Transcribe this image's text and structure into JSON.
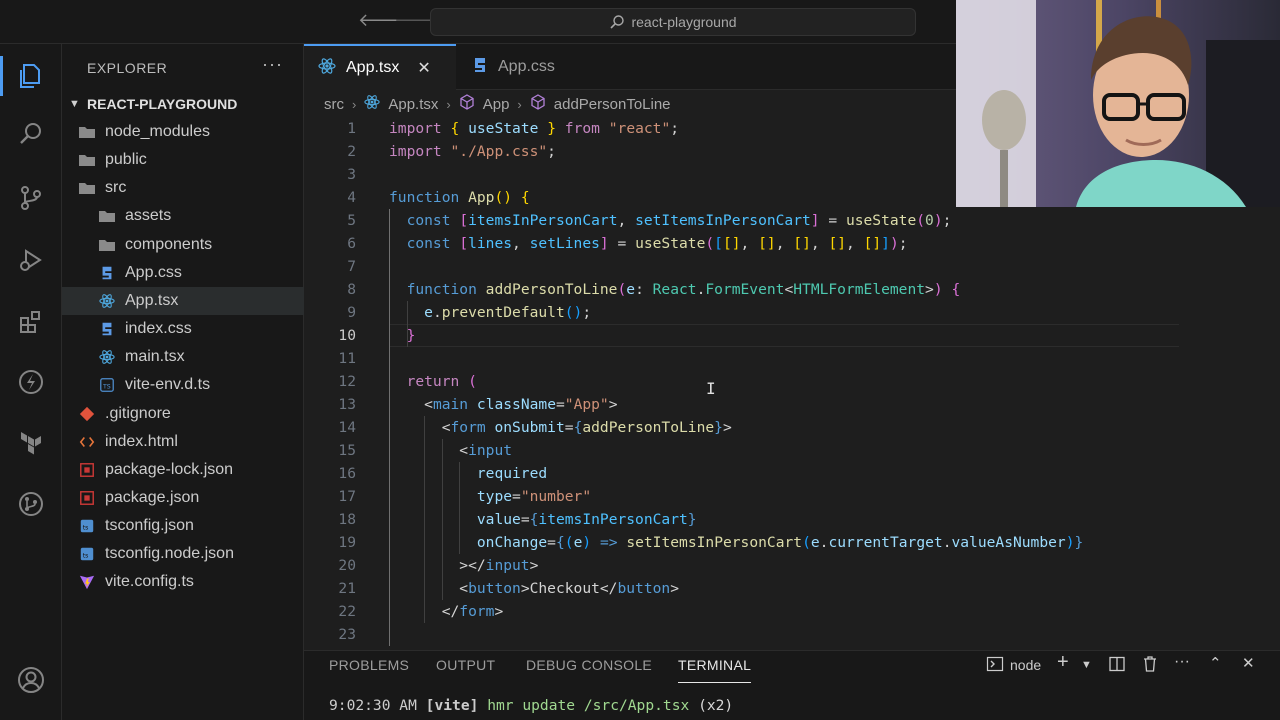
{
  "titlebar": {
    "search_text": "react-playground"
  },
  "sidebar": {
    "title": "EXPLORER",
    "more": "···",
    "project": "REACT-PLAYGROUND",
    "items": [
      {
        "label": "node_modules",
        "icon": "folder-icon",
        "indent": 0
      },
      {
        "label": "public",
        "icon": "folder-icon",
        "indent": 0
      },
      {
        "label": "src",
        "icon": "folder-icon",
        "indent": 0
      },
      {
        "label": "assets",
        "icon": "folder-icon",
        "indent": 1
      },
      {
        "label": "components",
        "icon": "folder-icon",
        "indent": 1
      },
      {
        "label": "App.css",
        "icon": "css-file-icon",
        "indent": 1
      },
      {
        "label": "App.tsx",
        "icon": "react-file-icon",
        "indent": 1,
        "selected": true
      },
      {
        "label": "index.css",
        "icon": "css-file-icon",
        "indent": 1
      },
      {
        "label": "main.tsx",
        "icon": "react-file-icon",
        "indent": 1
      },
      {
        "label": "vite-env.d.ts",
        "icon": "typescript-file-icon",
        "indent": 1
      },
      {
        "label": ".gitignore",
        "icon": "git-file-icon",
        "indent": 0
      },
      {
        "label": "index.html",
        "icon": "html-file-icon",
        "indent": 0
      },
      {
        "label": "package-lock.json",
        "icon": "npm-file-icon",
        "indent": 0
      },
      {
        "label": "package.json",
        "icon": "npm-file-icon",
        "indent": 0
      },
      {
        "label": "tsconfig.json",
        "icon": "tsconfig-file-icon",
        "indent": 0
      },
      {
        "label": "tsconfig.node.json",
        "icon": "tsconfig-file-icon",
        "indent": 0
      },
      {
        "label": "vite.config.ts",
        "icon": "vite-file-icon",
        "indent": 0
      }
    ]
  },
  "editor": {
    "tabs": [
      {
        "label": "App.tsx",
        "icon": "react-file-icon",
        "active": true,
        "close": "✕"
      },
      {
        "label": "App.css",
        "icon": "css-file-icon",
        "active": false
      }
    ],
    "breadcrumbs": [
      "src",
      "App.tsx",
      "App",
      "addPersonToLine"
    ],
    "current_line": 10,
    "lines": [
      [
        [
          "kw",
          "import"
        ],
        [
          "pn",
          " "
        ],
        [
          "br1",
          "{"
        ],
        [
          "pn",
          " "
        ],
        [
          "vr",
          "useState"
        ],
        [
          "pn",
          " "
        ],
        [
          "br1",
          "}"
        ],
        [
          "pn",
          " "
        ],
        [
          "kw",
          "from"
        ],
        [
          "pn",
          " "
        ],
        [
          "st",
          "\"react\""
        ],
        [
          "pn",
          ";"
        ]
      ],
      [
        [
          "kw",
          "import"
        ],
        [
          "pn",
          " "
        ],
        [
          "st",
          "\"./App.css\""
        ],
        [
          "pn",
          ";"
        ]
      ],
      [],
      [
        [
          "kb",
          "function"
        ],
        [
          "pn",
          " "
        ],
        [
          "fn",
          "App"
        ],
        [
          "br1",
          "()"
        ],
        [
          "pn",
          " "
        ],
        [
          "br1",
          "{"
        ]
      ],
      [
        [
          "pn",
          "  "
        ],
        [
          "kb",
          "const"
        ],
        [
          "pn",
          " "
        ],
        [
          "br2",
          "["
        ],
        [
          "cn",
          "itemsInPersonCart"
        ],
        [
          "pn",
          ", "
        ],
        [
          "cn",
          "setItemsInPersonCart"
        ],
        [
          "br2",
          "]"
        ],
        [
          "pn",
          " = "
        ],
        [
          "fn",
          "useState"
        ],
        [
          "br2",
          "("
        ],
        [
          "nm",
          "0"
        ],
        [
          "br2",
          ")"
        ],
        [
          "pn",
          ";"
        ]
      ],
      [
        [
          "pn",
          "  "
        ],
        [
          "kb",
          "const"
        ],
        [
          "pn",
          " "
        ],
        [
          "br2",
          "["
        ],
        [
          "cn",
          "lines"
        ],
        [
          "pn",
          ", "
        ],
        [
          "cn",
          "setLines"
        ],
        [
          "br2",
          "]"
        ],
        [
          "pn",
          " = "
        ],
        [
          "fn",
          "useState"
        ],
        [
          "br2",
          "("
        ],
        [
          "br3",
          "["
        ],
        [
          "br1",
          "[]"
        ],
        [
          "pn",
          ", "
        ],
        [
          "br1",
          "[]"
        ],
        [
          "pn",
          ", "
        ],
        [
          "br1",
          "[]"
        ],
        [
          "pn",
          ", "
        ],
        [
          "br1",
          "[]"
        ],
        [
          "pn",
          ", "
        ],
        [
          "br1",
          "[]"
        ],
        [
          "br3",
          "]"
        ],
        [
          "br2",
          ")"
        ],
        [
          "pn",
          ";"
        ]
      ],
      [],
      [
        [
          "pn",
          "  "
        ],
        [
          "kb",
          "function"
        ],
        [
          "pn",
          " "
        ],
        [
          "fn",
          "addPersonToLine"
        ],
        [
          "br2",
          "("
        ],
        [
          "vr",
          "e"
        ],
        [
          "pn",
          ": "
        ],
        [
          "tp",
          "React"
        ],
        [
          "pn",
          "."
        ],
        [
          "tp",
          "FormEvent"
        ],
        [
          "pn",
          "<"
        ],
        [
          "tp",
          "HTMLFormElement"
        ],
        [
          "pn",
          ">"
        ],
        [
          "br2",
          ")"
        ],
        [
          "pn",
          " "
        ],
        [
          "br2",
          "{"
        ]
      ],
      [
        [
          "pn",
          "    "
        ],
        [
          "vr",
          "e"
        ],
        [
          "pn",
          "."
        ],
        [
          "fn",
          "preventDefault"
        ],
        [
          "br3",
          "()"
        ],
        [
          "pn",
          ";"
        ]
      ],
      [
        [
          "pn",
          "  "
        ],
        [
          "br2",
          "}"
        ]
      ],
      [],
      [
        [
          "pn",
          "  "
        ],
        [
          "kw",
          "return"
        ],
        [
          "pn",
          " "
        ],
        [
          "br2",
          "("
        ]
      ],
      [
        [
          "pn",
          "    "
        ],
        [
          "pn",
          "<"
        ],
        [
          "tg",
          "main"
        ],
        [
          "pn",
          " "
        ],
        [
          "at",
          "className"
        ],
        [
          "pn",
          "="
        ],
        [
          "st",
          "\"App\""
        ],
        [
          "pn",
          ">"
        ]
      ],
      [
        [
          "pn",
          "      "
        ],
        [
          "pn",
          "<"
        ],
        [
          "tg",
          "form"
        ],
        [
          "pn",
          " "
        ],
        [
          "at",
          "onSubmit"
        ],
        [
          "pn",
          "="
        ],
        [
          "kb",
          "{"
        ],
        [
          "fn",
          "addPersonToLine"
        ],
        [
          "kb",
          "}"
        ],
        [
          "pn",
          ">"
        ]
      ],
      [
        [
          "pn",
          "        "
        ],
        [
          "pn",
          "<"
        ],
        [
          "tg",
          "input"
        ]
      ],
      [
        [
          "pn",
          "          "
        ],
        [
          "at",
          "required"
        ]
      ],
      [
        [
          "pn",
          "          "
        ],
        [
          "at",
          "type"
        ],
        [
          "pn",
          "="
        ],
        [
          "st",
          "\"number\""
        ]
      ],
      [
        [
          "pn",
          "          "
        ],
        [
          "at",
          "value"
        ],
        [
          "pn",
          "="
        ],
        [
          "kb",
          "{"
        ],
        [
          "cn",
          "itemsInPersonCart"
        ],
        [
          "kb",
          "}"
        ]
      ],
      [
        [
          "pn",
          "          "
        ],
        [
          "at",
          "onChange"
        ],
        [
          "pn",
          "="
        ],
        [
          "kb",
          "{"
        ],
        [
          "br3",
          "("
        ],
        [
          "vr",
          "e"
        ],
        [
          "br3",
          ")"
        ],
        [
          "pn",
          " "
        ],
        [
          "kb",
          "=>"
        ],
        [
          "pn",
          " "
        ],
        [
          "fn",
          "setItemsInPersonCart"
        ],
        [
          "br3",
          "("
        ],
        [
          "vr",
          "e"
        ],
        [
          "pn",
          "."
        ],
        [
          "vr",
          "currentTarget"
        ],
        [
          "pn",
          "."
        ],
        [
          "vr",
          "valueAsNumber"
        ],
        [
          "br3",
          ")"
        ],
        [
          "kb",
          "}"
        ]
      ],
      [
        [
          "pn",
          "        "
        ],
        [
          "pn",
          "></"
        ],
        [
          "tg",
          "input"
        ],
        [
          "pn",
          ">"
        ]
      ],
      [
        [
          "pn",
          "        "
        ],
        [
          "pn",
          "<"
        ],
        [
          "tg",
          "button"
        ],
        [
          "pn",
          ">Checkout</"
        ],
        [
          "tg",
          "button"
        ],
        [
          "pn",
          ">"
        ]
      ],
      [
        [
          "pn",
          "      "
        ],
        [
          "pn",
          "</"
        ],
        [
          "tg",
          "form"
        ],
        [
          "pn",
          ">"
        ]
      ],
      []
    ]
  },
  "panel": {
    "tabs": [
      "PROBLEMS",
      "OUTPUT",
      "DEBUG CONSOLE",
      "TERMINAL"
    ],
    "active_tab": "TERMINAL",
    "terminal_name": "node",
    "terminal_line": {
      "time": "9:02:30 AM",
      "tag": "[vite]",
      "message": "hmr update /src/App.tsx",
      "count": "(x2)"
    }
  },
  "colors": {
    "accent": "#4d9cf2",
    "background": "#1e1e1e",
    "sidebar": "#181818"
  }
}
